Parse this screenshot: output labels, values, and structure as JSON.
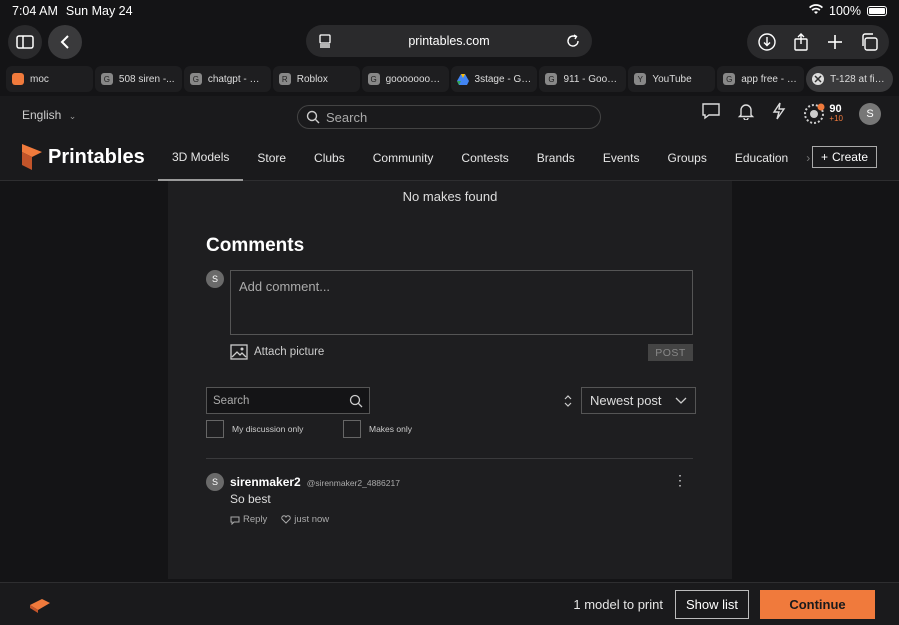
{
  "status_bar": {
    "time": "7:04 AM",
    "date": "Sun May 24",
    "battery": "100%"
  },
  "browser": {
    "url": "printables.com",
    "tabs": [
      {
        "label": "moc",
        "favicon": "printables-icon"
      },
      {
        "label": "508 siren -...",
        "favicon": "G"
      },
      {
        "label": "chatgpt - Go...",
        "favicon": "G"
      },
      {
        "label": "Roblox",
        "favicon": "R"
      },
      {
        "label": "gooooooooo...",
        "favicon": "G"
      },
      {
        "label": "3stage - Goo...",
        "favicon": "drive-icon"
      },
      {
        "label": "911 - Google...",
        "favicon": "G"
      },
      {
        "label": "YouTube",
        "favicon": "Y"
      },
      {
        "label": "app free - G...",
        "favicon": "G"
      },
      {
        "label": "T-128 at fire...",
        "favicon": "close-icon",
        "active": true
      }
    ]
  },
  "site_header": {
    "language": "English",
    "search_placeholder": "Search",
    "points": "90",
    "points_delta": "+10",
    "avatar_initial": "S"
  },
  "nav": {
    "brand": "Printables",
    "items": [
      "3D Models",
      "Store",
      "Clubs",
      "Community",
      "Contests",
      "Brands",
      "Events",
      "Groups",
      "Education"
    ],
    "active_index": 0,
    "create_label": "Create"
  },
  "main": {
    "no_makes": "No makes found",
    "comments_title": "Comments",
    "user_initial": "S",
    "comment_placeholder": "Add comment...",
    "attach_label": "Attach picture",
    "post_label": "POST",
    "filter_search_placeholder": "Search",
    "sort_label": "Newest post",
    "checkbox_discussion": "My discussion only",
    "checkbox_makes": "Makes only",
    "comment": {
      "initial": "S",
      "author": "sirenmaker2",
      "handle": "@sirenmaker2_4886217",
      "text": "So best",
      "reply_label": "Reply",
      "time": "just now"
    }
  },
  "bottom_bar": {
    "count_label": "1 model to print",
    "show_list_label": "Show list",
    "continue_label": "Continue"
  },
  "colors": {
    "accent": "#f07a3c",
    "background": "#141416",
    "card": "#1e1e20"
  }
}
